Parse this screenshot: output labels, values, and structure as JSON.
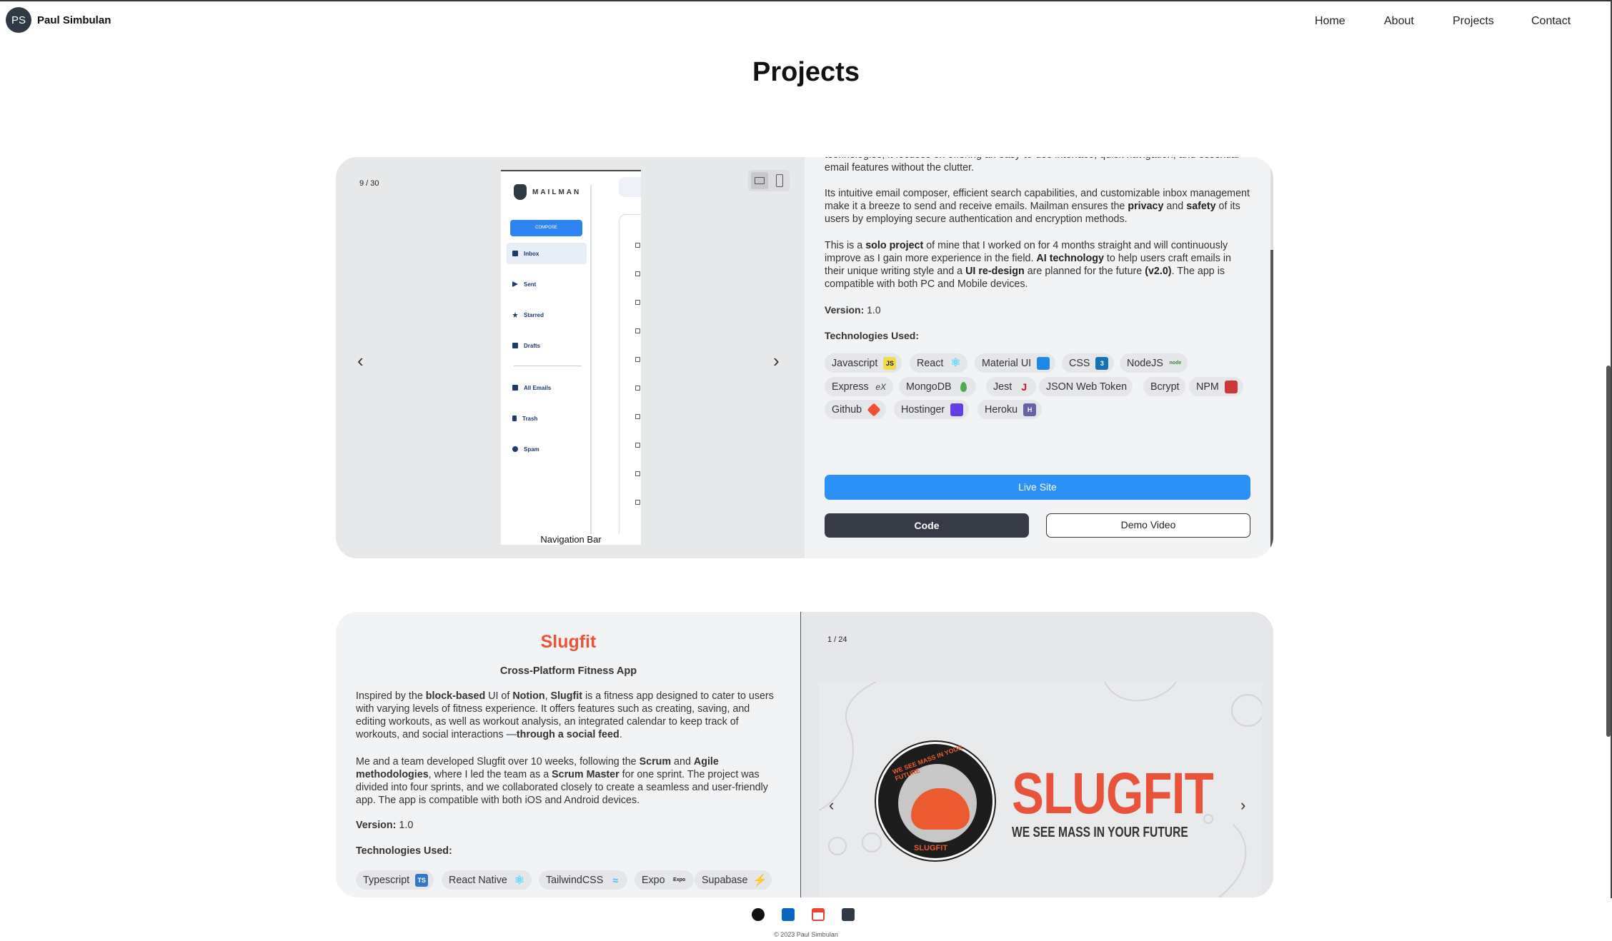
{
  "brand": {
    "initials": "PS",
    "name": "Paul Simbulan"
  },
  "nav": {
    "home": "Home",
    "about": "About",
    "projects": "Projects",
    "contact": "Contact"
  },
  "page_title": "Projects",
  "project1": {
    "counter": "9 / 30",
    "mock": {
      "logo": "MAILMAN",
      "compose": "COMPOSE",
      "items": [
        "Inbox",
        "Sent",
        "Starred",
        "Drafts",
        "All Emails",
        "Trash",
        "Spam"
      ],
      "caption": "Navigation Bar"
    },
    "p0": "technologies, it focuses on offering an easy-to-use interface, quick navigation, and essential email features without the clutter.",
    "p1a": "Its intuitive email composer, efficient search capabilities, and customizable inbox management make it a breeze to send and receive emails. Mailman ensures the ",
    "p1b": "privacy",
    "p1c": " and ",
    "p1d": "safety",
    "p1e": " of its users by employing secure authentication and encryption methods.",
    "p2a": "This is a ",
    "p2b": "solo project",
    "p2c": " of mine that I worked on for 4 months straight and will continuously improve as I gain more experience in the field. ",
    "p2d": "AI technology",
    "p2e": " to help users craft emails in their unique writing style and a ",
    "p2f": "UI re-design",
    "p2g": " are planned for the future ",
    "p2h": "(v2.0)",
    "p2i": ". The app is compatible with both PC and Mobile devices.",
    "version_label": "Version:",
    "version": "1.0",
    "tech_label": "Technologies Used:",
    "techs": [
      "Javascript",
      "React",
      "Material UI",
      "CSS",
      "NodeJS",
      "Express",
      "MongoDB",
      "Jest",
      "JSON Web Token",
      "Bcrypt",
      "NPM",
      "Github",
      "Hostinger",
      "Heroku"
    ],
    "tech_icons": {
      "Javascript": "JS",
      "CSS": "3",
      "NodeJS": "node",
      "Express": "eX",
      "Heroku": "H"
    },
    "live": "Live Site",
    "code": "Code",
    "demo": "Demo Video"
  },
  "project2": {
    "title": "Slugfit",
    "subtitle": "Cross-Platform Fitness App",
    "p1a": "Inspired by the ",
    "p1b": "block-based",
    "p1c": " UI of ",
    "p1d": "Notion",
    "p1e": ", ",
    "p1f": "Slugfit",
    "p1g": " is a fitness app designed to cater to users with varying levels of fitness experience. It offers features such as creating, saving, and editing workouts, as well as workout analysis, an integrated calendar to keep track of workouts, and social interactions —",
    "p1h": "through a social feed",
    "p1i": ".",
    "p2a": "Me and a team developed Slugfit over 10 weeks, following the ",
    "p2b": "Scrum",
    "p2c": " and ",
    "p2d": "Agile methodologies",
    "p2e": ", where I led the team as a ",
    "p2f": "Scrum Master",
    "p2g": " for one sprint. The project was divided into four sprints, and we collaborated closely to create a seamless and user-friendly app. The app is compatible with both iOS and Android devices.",
    "version_label": "Version:",
    "version": "1.0",
    "tech_label": "Technologies Used:",
    "techs": [
      "Typescript",
      "React Native",
      "TailwindCSS",
      "Expo",
      "Supabase"
    ],
    "tech_icons": {
      "Typescript": "TS",
      "Expo": "Expo"
    },
    "counter": "1 / 24",
    "logo_word": "SLUGFIT",
    "logo_tagline": "WE SEE MASS IN YOUR FUTURE",
    "badge_top": "WE SEE MASS IN YOUR FUTURE",
    "badge_bottom": "SLUGFIT"
  },
  "footer": {
    "copyright": "© 2023 Paul Simbulan"
  },
  "colors": {
    "accent": "#2b90f7",
    "slugfit": "#e8533a",
    "dark_button": "#363b46"
  }
}
